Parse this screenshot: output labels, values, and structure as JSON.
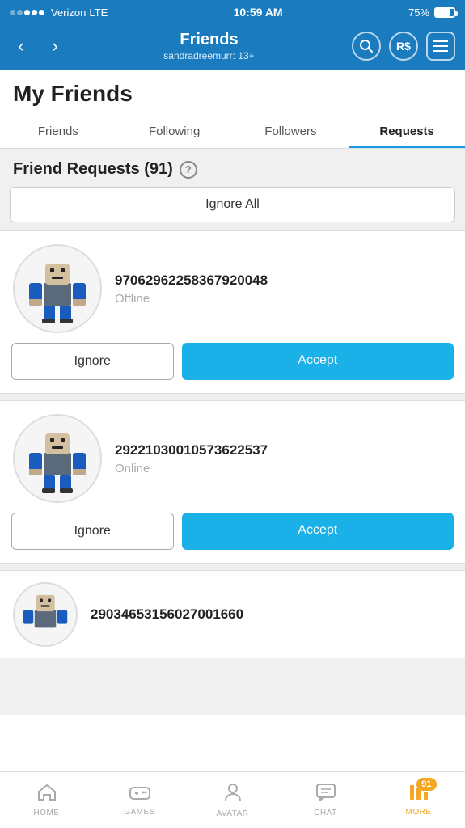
{
  "statusBar": {
    "carrier": "Verizon",
    "networkType": "LTE",
    "time": "10:59 AM",
    "battery": "75%",
    "dots": [
      false,
      false,
      true,
      true,
      true
    ]
  },
  "header": {
    "title": "Friends",
    "subtitle": "sandradreemurr: 13+",
    "backLabel": "‹",
    "forwardLabel": "›"
  },
  "pageTitle": "My Friends",
  "tabs": [
    {
      "label": "Friends",
      "active": false
    },
    {
      "label": "Following",
      "active": false
    },
    {
      "label": "Followers",
      "active": false
    },
    {
      "label": "Requests",
      "active": true
    }
  ],
  "sectionTitle": "Friend Requests (91)",
  "ignoreAllLabel": "Ignore All",
  "requests": [
    {
      "username": "97062962258367920048",
      "status": "Offline",
      "statusType": "offline"
    },
    {
      "username": "29221030010573622537",
      "status": "Online",
      "statusType": "online"
    },
    {
      "username": "29034653156027001660",
      "status": "",
      "statusType": "partial"
    }
  ],
  "buttons": {
    "ignore": "Ignore",
    "accept": "Accept"
  },
  "bottomNav": [
    {
      "label": "HOME",
      "icon": "⌂",
      "active": false
    },
    {
      "label": "GAMES",
      "icon": "🎮",
      "active": false
    },
    {
      "label": "AVATAR",
      "icon": "👤",
      "active": false
    },
    {
      "label": "CHAT",
      "icon": "💬",
      "active": false
    },
    {
      "label": "MORE",
      "icon": "📶",
      "active": true,
      "badge": "91"
    }
  ]
}
